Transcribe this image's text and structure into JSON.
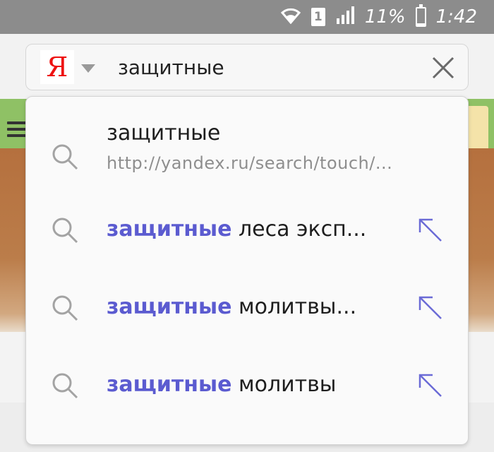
{
  "status_bar": {
    "sim_slot": "1",
    "battery_text": "11%",
    "battery_level": 0.11,
    "time": "1:42",
    "icons": [
      "wifi-icon",
      "sim-icon",
      "signal-icon",
      "battery-icon"
    ]
  },
  "urlbar": {
    "logo_letter": "Я",
    "query": "защитные",
    "colors": {
      "logo": "#ee1111",
      "highlight": "#5b5bd0"
    }
  },
  "suggestions": [
    {
      "highlight": "",
      "rest": "защитные",
      "url": "http://yandex.ru/search/touch/...",
      "has_arrow": false
    },
    {
      "highlight": "защитные",
      "rest": " леса эксп...",
      "has_arrow": true
    },
    {
      "highlight": "защитные",
      "rest": " молитвы...",
      "has_arrow": true
    },
    {
      "highlight": "защитные",
      "rest": " молитвы",
      "has_arrow": true
    }
  ]
}
